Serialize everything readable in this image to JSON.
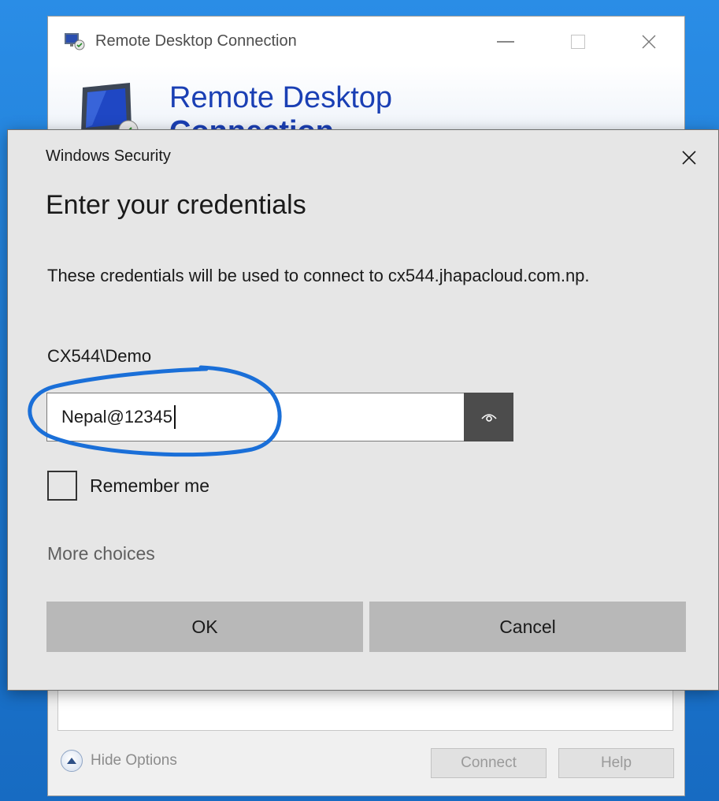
{
  "rdc_window": {
    "title": "Remote Desktop Connection",
    "banner_line1": "Remote Desktop",
    "banner_line2": "Connection",
    "hide_options": "Hide Options",
    "connect_label": "Connect",
    "help_label": "Help"
  },
  "security_dialog": {
    "title": "Windows Security",
    "heading": "Enter your credentials",
    "description": "These credentials will be used to connect to cx544.jhapacloud.com.np.",
    "username": "CX544\\Demo",
    "password_value": "Nepal@12345",
    "remember_label": "Remember me",
    "remember_checked": false,
    "more_choices": "More choices",
    "ok_label": "OK",
    "cancel_label": "Cancel"
  },
  "colors": {
    "desktop": "#1e7fd6",
    "dialog_bg": "#e6e6e6",
    "button_bg": "#b8b8b8",
    "reveal_bg": "#4c4c4c",
    "banner_text": "#1a3fb4",
    "annotation": "#1a6fd8"
  },
  "icons": {
    "rdc_app": "remote-desktop-icon",
    "reveal": "eye-icon",
    "close": "close-icon",
    "hide_options": "chevron-up-circle-icon"
  }
}
